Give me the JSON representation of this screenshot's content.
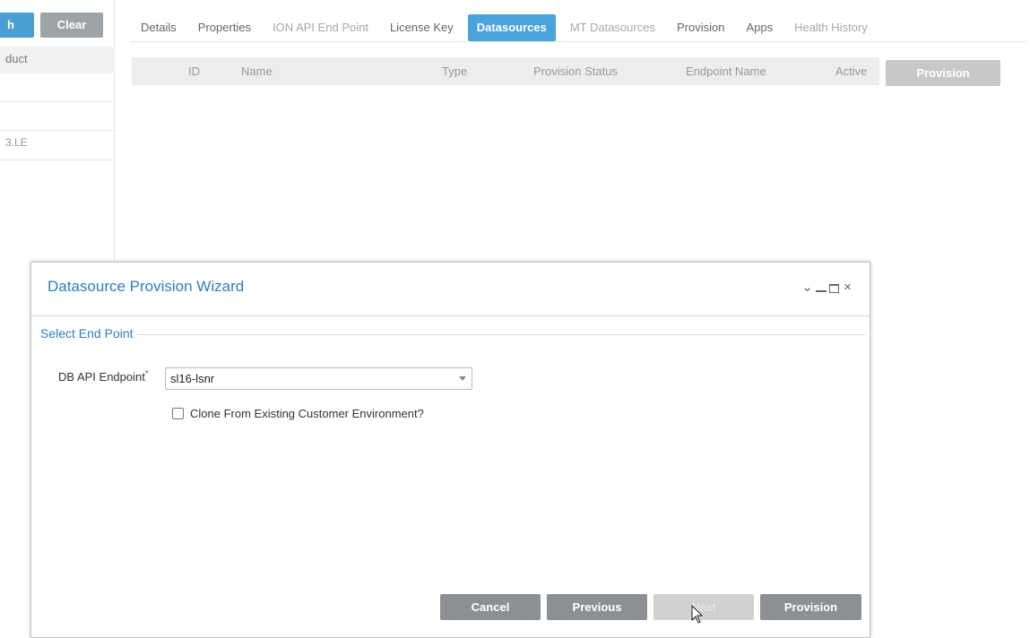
{
  "left_panel": {
    "search_button_label": "h",
    "clear_button_label": "Clear",
    "row1_text": "duct",
    "row2_text": "3.LE"
  },
  "tabs": [
    {
      "label": "Details",
      "state": "normal"
    },
    {
      "label": "Properties",
      "state": "normal"
    },
    {
      "label": "ION API End Point",
      "state": "dim"
    },
    {
      "label": "License Key",
      "state": "normal"
    },
    {
      "label": "Datasources",
      "state": "active"
    },
    {
      "label": "MT Datasources",
      "state": "dim"
    },
    {
      "label": "Provision",
      "state": "normal"
    },
    {
      "label": "Apps",
      "state": "normal"
    },
    {
      "label": "Health History",
      "state": "dim"
    }
  ],
  "grid": {
    "columns": [
      "ID",
      "Name",
      "Type",
      "Provision Status",
      "Endpoint Name",
      "Active"
    ],
    "provision_button_label": "Provision"
  },
  "modal": {
    "title": "Datasource Provision Wizard",
    "window_controls": [
      "chevron-down-icon",
      "minimize-icon",
      "maximize-icon",
      "close-icon"
    ],
    "section_title": "Select End Point",
    "db_api_endpoint_label": "DB API Endpoint",
    "required_marker": "*",
    "db_api_endpoint_value": "sl16-lsnr",
    "clone_checkbox_label": "Clone From Existing Customer Environment?",
    "clone_checked": false,
    "buttons": {
      "cancel": "Cancel",
      "previous": "Previous",
      "next": "Next",
      "provision": "Provision"
    }
  },
  "colors": {
    "accent": "#4aa3db",
    "title_blue": "#2e7fc0",
    "button_gray": "#8c8f93",
    "disabled_gray": "#d1d1d1"
  }
}
